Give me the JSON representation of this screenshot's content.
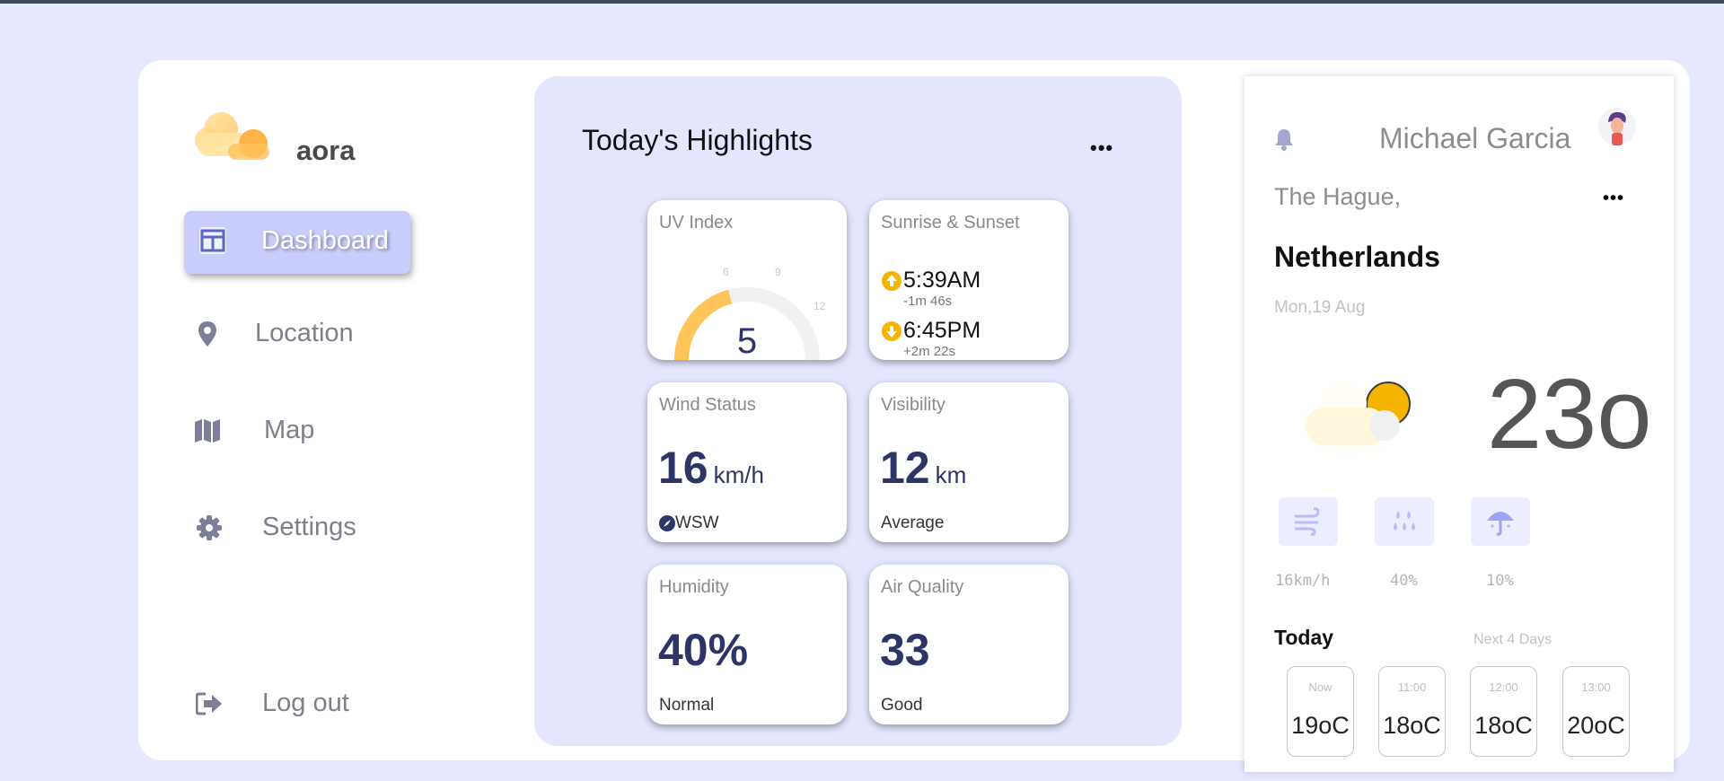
{
  "app": {
    "brand": "aora"
  },
  "sidebar": {
    "items": [
      {
        "label": "Dashboard",
        "icon": "dashboard-icon",
        "active": true
      },
      {
        "label": "Location",
        "icon": "location-pin-icon"
      },
      {
        "label": "Map",
        "icon": "map-icon"
      },
      {
        "label": "Settings",
        "icon": "gear-icon"
      }
    ],
    "logout": {
      "label": "Log out",
      "icon": "logout-icon"
    }
  },
  "highlights": {
    "title": "Today's Highlights",
    "more": "•••",
    "uv": {
      "title": "UV Index",
      "value": "5",
      "level": 5,
      "max": 12,
      "ticks": [
        "6",
        "9",
        "12"
      ]
    },
    "sun": {
      "title": "Sunrise & Sunset",
      "sunrise": "5:39AM",
      "sunrise_delta": "-1m 46s",
      "sunset": "6:45PM",
      "sunset_delta": "+2m 22s"
    },
    "wind": {
      "title": "Wind Status",
      "value": "16",
      "unit": "km/h",
      "direction": "WSW"
    },
    "visibility": {
      "title": "Visibility",
      "value": "12",
      "unit": "km",
      "status": "Average"
    },
    "humidity": {
      "title": "Humidity",
      "value": "40%",
      "status": "Normal"
    },
    "air": {
      "title": "Air Quality",
      "value": "33",
      "status": "Good"
    }
  },
  "profile": {
    "name": "Michael Garcia",
    "city": "The Hague,",
    "country": "Netherlands",
    "date": "Mon,19 Aug",
    "temperature": "23o",
    "more": "•••",
    "stats": {
      "wind": "16km/h",
      "humidity": "40%",
      "rain": "10%"
    },
    "today_label": "Today",
    "next_label": "Next 4 Days",
    "hourly": [
      {
        "time": "Now",
        "temp": "19oC"
      },
      {
        "time": "11:00",
        "temp": "18oC"
      },
      {
        "time": "12:00",
        "temp": "18oC"
      },
      {
        "time": "13:00",
        "temp": "20oC"
      }
    ]
  },
  "colors": {
    "background": "#e6e8fe",
    "panel": "#e4e6fd",
    "accent": "#c9cdfb",
    "navy": "#2d3467",
    "sun": "#f4b400"
  }
}
